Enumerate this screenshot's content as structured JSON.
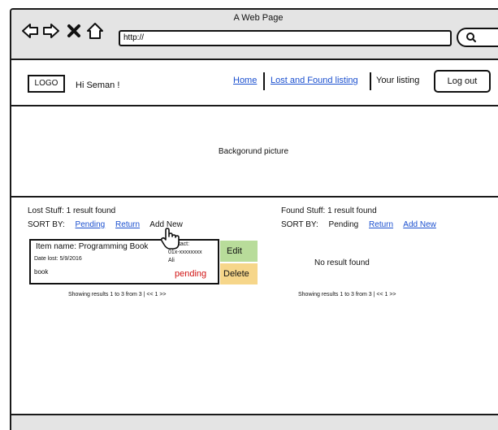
{
  "window": {
    "title": "A Web Page"
  },
  "browser": {
    "address_value": "http://",
    "icons": [
      "back-arrow-icon",
      "forward-arrow-icon",
      "close-x-icon",
      "home-icon",
      "search-icon"
    ]
  },
  "header": {
    "logo_text": "LOGO",
    "greeting": "Hi Seman !",
    "nav": {
      "home": "Home",
      "lost_found": "Lost and Found listing",
      "your_listing": "Your listing"
    },
    "logout_label": "Log out"
  },
  "hero": {
    "label": "Backgorund picture"
  },
  "lost": {
    "title": "Lost Stuff: 1 result found",
    "sort_label": "SORT BY:",
    "sort_options": [
      "Pending",
      "Return",
      "Add New"
    ],
    "item": {
      "name": "Item name: Programming Book",
      "date": "Date lost: 5/9/2016",
      "description": "book",
      "contact_label": "Contact:",
      "contact_phone": "01x-xxxxxxxx",
      "contact_name": "Ali",
      "status": "pending"
    },
    "edit_label": "Edit",
    "delete_label": "Delete",
    "pager": "Showing results 1 to 3 from 3  |  << 1 >>"
  },
  "found": {
    "title": "Found Stuff: 1 result found",
    "sort_label": "SORT BY:",
    "sort_options": [
      "Pending",
      "Return",
      "Add New"
    ],
    "empty_message": "No result found",
    "pager": "Showing results 1 to 3 from 3  |  << 1 >>"
  },
  "colors": {
    "link": "#1a4fcf",
    "edit_bg": "#b8dc9a",
    "delete_bg": "#f6d68a",
    "pending": "#d11414",
    "chrome_bg": "#e4e4e4"
  }
}
